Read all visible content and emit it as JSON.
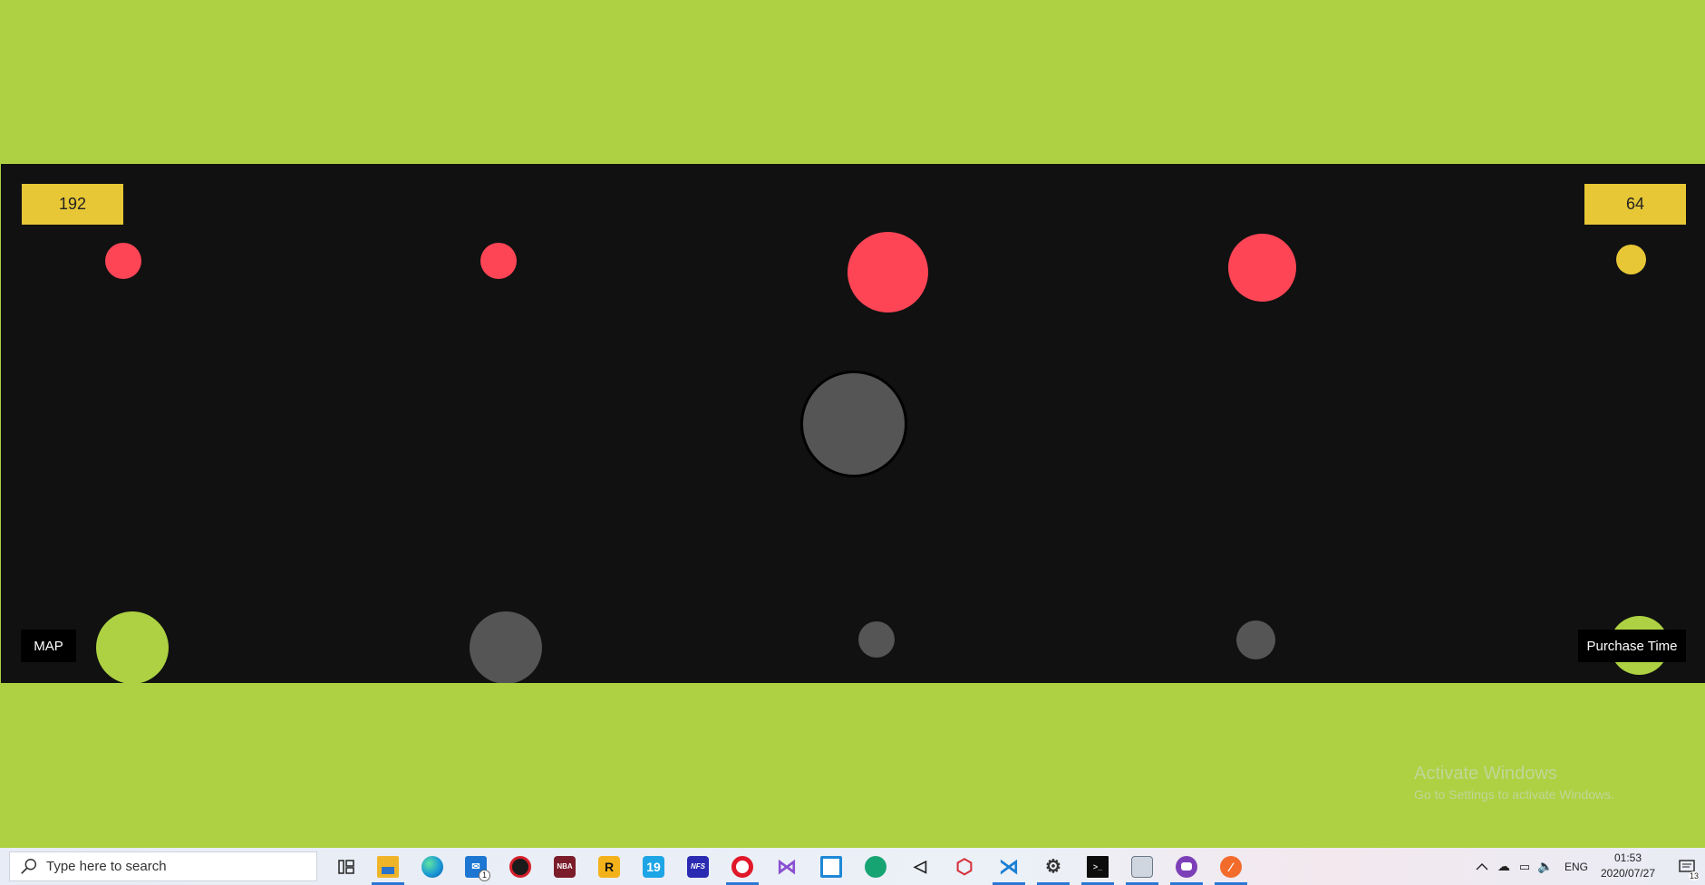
{
  "game": {
    "score_left": "192",
    "score_right": "64",
    "map_button_label": "MAP",
    "purchase_button_label": "Purchase Time",
    "colors": {
      "background_band": "#add142",
      "arena": "#111111",
      "enemy": "#fd4556",
      "neutral": "#555555",
      "coin": "#e8c736",
      "ally": "#add142"
    }
  },
  "watermark": {
    "title": "Activate Windows",
    "subtitle": "Go to Settings to activate Windows."
  },
  "taskbar": {
    "search_placeholder": "Type here to search",
    "pinned_apps": [
      "task-view-icon",
      "file-explorer-icon",
      "edge-icon",
      "mail-icon",
      "red-app-icon",
      "game-app-icon",
      "rockstar-icon",
      "fifa19-icon",
      "nfs-icon",
      "opera-icon",
      "visual-studio-icon",
      "virtualbox-icon",
      "gitkraken-icon",
      "unity-icon",
      "red-hex-icon",
      "vscode-icon",
      "settings-icon",
      "terminal-icon",
      "photos-icon",
      "github-desktop-icon",
      "postman-icon"
    ],
    "mail_badge": "1",
    "tray": {
      "language": "ENG",
      "time": "01:53",
      "date": "2020/07/27",
      "notification_count": "13"
    }
  }
}
